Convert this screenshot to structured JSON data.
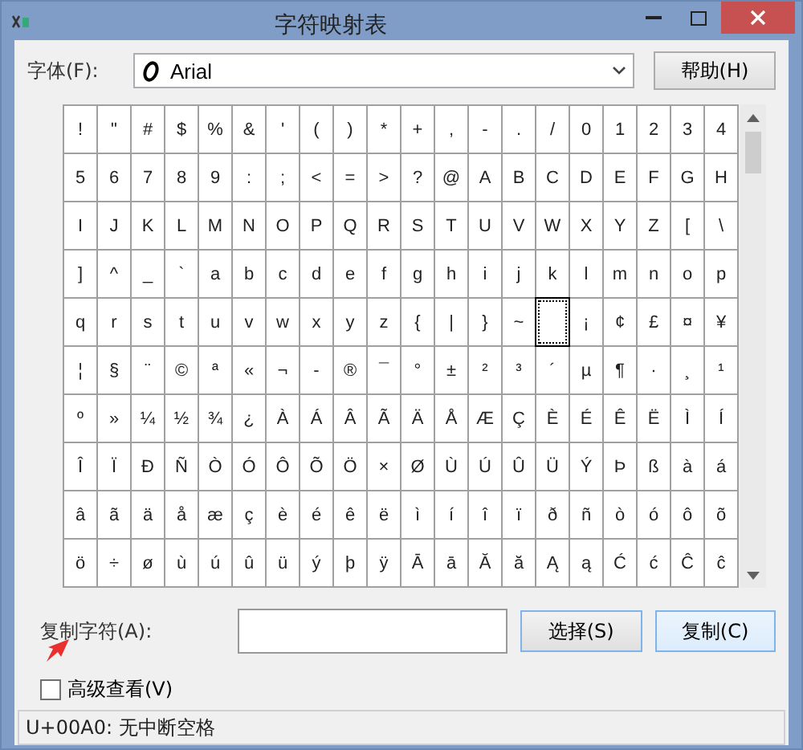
{
  "window": {
    "title": "字符映射表"
  },
  "font": {
    "label": "字体(F):",
    "value": "Arial"
  },
  "help_button": "帮助(H)",
  "grid": {
    "rows": [
      {
        "cells": [
          {
            "char": "!",
            "selected": false
          },
          {
            "char": "\"",
            "selected": false
          },
          {
            "char": "#",
            "selected": false
          },
          {
            "char": "$",
            "selected": false
          },
          {
            "char": "%",
            "selected": false
          },
          {
            "char": "&",
            "selected": false
          },
          {
            "char": "'",
            "selected": false
          },
          {
            "char": "(",
            "selected": false
          },
          {
            "char": ")",
            "selected": false
          },
          {
            "char": "*",
            "selected": false
          },
          {
            "char": "+",
            "selected": false
          },
          {
            "char": ",",
            "selected": false
          },
          {
            "char": "-",
            "selected": false
          },
          {
            "char": ".",
            "selected": false
          },
          {
            "char": "/",
            "selected": false
          },
          {
            "char": "0",
            "selected": false
          },
          {
            "char": "1",
            "selected": false
          },
          {
            "char": "2",
            "selected": false
          },
          {
            "char": "3",
            "selected": false
          },
          {
            "char": "4",
            "selected": false
          }
        ]
      },
      {
        "cells": [
          {
            "char": "5",
            "selected": false
          },
          {
            "char": "6",
            "selected": false
          },
          {
            "char": "7",
            "selected": false
          },
          {
            "char": "8",
            "selected": false
          },
          {
            "char": "9",
            "selected": false
          },
          {
            "char": ":",
            "selected": false
          },
          {
            "char": ";",
            "selected": false
          },
          {
            "char": "<",
            "selected": false
          },
          {
            "char": "=",
            "selected": false
          },
          {
            "char": ">",
            "selected": false
          },
          {
            "char": "?",
            "selected": false
          },
          {
            "char": "@",
            "selected": false
          },
          {
            "char": "A",
            "selected": false
          },
          {
            "char": "B",
            "selected": false
          },
          {
            "char": "C",
            "selected": false
          },
          {
            "char": "D",
            "selected": false
          },
          {
            "char": "E",
            "selected": false
          },
          {
            "char": "F",
            "selected": false
          },
          {
            "char": "G",
            "selected": false
          },
          {
            "char": "H",
            "selected": false
          }
        ]
      },
      {
        "cells": [
          {
            "char": "I",
            "selected": false
          },
          {
            "char": "J",
            "selected": false
          },
          {
            "char": "K",
            "selected": false
          },
          {
            "char": "L",
            "selected": false
          },
          {
            "char": "M",
            "selected": false
          },
          {
            "char": "N",
            "selected": false
          },
          {
            "char": "O",
            "selected": false
          },
          {
            "char": "P",
            "selected": false
          },
          {
            "char": "Q",
            "selected": false
          },
          {
            "char": "R",
            "selected": false
          },
          {
            "char": "S",
            "selected": false
          },
          {
            "char": "T",
            "selected": false
          },
          {
            "char": "U",
            "selected": false
          },
          {
            "char": "V",
            "selected": false
          },
          {
            "char": "W",
            "selected": false
          },
          {
            "char": "X",
            "selected": false
          },
          {
            "char": "Y",
            "selected": false
          },
          {
            "char": "Z",
            "selected": false
          },
          {
            "char": "[",
            "selected": false
          },
          {
            "char": "\\",
            "selected": false
          }
        ]
      },
      {
        "cells": [
          {
            "char": "]",
            "selected": false
          },
          {
            "char": "^",
            "selected": false
          },
          {
            "char": "_",
            "selected": false
          },
          {
            "char": "`",
            "selected": false
          },
          {
            "char": "a",
            "selected": false
          },
          {
            "char": "b",
            "selected": false
          },
          {
            "char": "c",
            "selected": false
          },
          {
            "char": "d",
            "selected": false
          },
          {
            "char": "e",
            "selected": false
          },
          {
            "char": "f",
            "selected": false
          },
          {
            "char": "g",
            "selected": false
          },
          {
            "char": "h",
            "selected": false
          },
          {
            "char": "i",
            "selected": false
          },
          {
            "char": "j",
            "selected": false
          },
          {
            "char": "k",
            "selected": false
          },
          {
            "char": "l",
            "selected": false
          },
          {
            "char": "m",
            "selected": false
          },
          {
            "char": "n",
            "selected": false
          },
          {
            "char": "o",
            "selected": false
          },
          {
            "char": "p",
            "selected": false
          }
        ]
      },
      {
        "cells": [
          {
            "char": "q",
            "selected": false
          },
          {
            "char": "r",
            "selected": false
          },
          {
            "char": "s",
            "selected": false
          },
          {
            "char": "t",
            "selected": false
          },
          {
            "char": "u",
            "selected": false
          },
          {
            "char": "v",
            "selected": false
          },
          {
            "char": "w",
            "selected": false
          },
          {
            "char": "x",
            "selected": false
          },
          {
            "char": "y",
            "selected": false
          },
          {
            "char": "z",
            "selected": false
          },
          {
            "char": "{",
            "selected": false
          },
          {
            "char": "|",
            "selected": false
          },
          {
            "char": "}",
            "selected": false
          },
          {
            "char": "~",
            "selected": false
          },
          {
            "selected": true
          },
          {
            "char": "¡",
            "selected": false
          },
          {
            "char": "¢",
            "selected": false
          },
          {
            "char": "£",
            "selected": false
          },
          {
            "char": "¤",
            "selected": false
          },
          {
            "char": "¥",
            "selected": false
          }
        ]
      },
      {
        "cells": [
          {
            "char": "¦",
            "selected": false
          },
          {
            "char": "§",
            "selected": false
          },
          {
            "char": "¨",
            "selected": false
          },
          {
            "char": "©",
            "selected": false
          },
          {
            "char": "ª",
            "selected": false
          },
          {
            "char": "«",
            "selected": false
          },
          {
            "char": "¬",
            "selected": false
          },
          {
            "char": "-",
            "selected": false
          },
          {
            "char": "®",
            "selected": false
          },
          {
            "char": "¯",
            "selected": false
          },
          {
            "char": "°",
            "selected": false
          },
          {
            "char": "±",
            "selected": false
          },
          {
            "char": "²",
            "selected": false
          },
          {
            "char": "³",
            "selected": false
          },
          {
            "char": "´",
            "selected": false
          },
          {
            "char": "µ",
            "selected": false
          },
          {
            "char": "¶",
            "selected": false
          },
          {
            "char": "·",
            "selected": false
          },
          {
            "char": "¸",
            "selected": false
          },
          {
            "char": "¹",
            "selected": false
          }
        ]
      },
      {
        "cells": [
          {
            "char": "º",
            "selected": false
          },
          {
            "char": "»",
            "selected": false
          },
          {
            "char": "¼",
            "selected": false
          },
          {
            "char": "½",
            "selected": false
          },
          {
            "char": "¾",
            "selected": false
          },
          {
            "char": "¿",
            "selected": false
          },
          {
            "char": "À",
            "selected": false
          },
          {
            "char": "Á",
            "selected": false
          },
          {
            "char": "Â",
            "selected": false
          },
          {
            "char": "Ã",
            "selected": false
          },
          {
            "char": "Ä",
            "selected": false
          },
          {
            "char": "Å",
            "selected": false
          },
          {
            "char": "Æ",
            "selected": false
          },
          {
            "char": "Ç",
            "selected": false
          },
          {
            "char": "È",
            "selected": false
          },
          {
            "char": "É",
            "selected": false
          },
          {
            "char": "Ê",
            "selected": false
          },
          {
            "char": "Ë",
            "selected": false
          },
          {
            "char": "Ì",
            "selected": false
          },
          {
            "char": "Í",
            "selected": false
          }
        ]
      },
      {
        "cells": [
          {
            "char": "Î",
            "selected": false
          },
          {
            "char": "Ï",
            "selected": false
          },
          {
            "char": "Ð",
            "selected": false
          },
          {
            "char": "Ñ",
            "selected": false
          },
          {
            "char": "Ò",
            "selected": false
          },
          {
            "char": "Ó",
            "selected": false
          },
          {
            "char": "Ô",
            "selected": false
          },
          {
            "char": "Õ",
            "selected": false
          },
          {
            "char": "Ö",
            "selected": false
          },
          {
            "char": "×",
            "selected": false
          },
          {
            "char": "Ø",
            "selected": false
          },
          {
            "char": "Ù",
            "selected": false
          },
          {
            "char": "Ú",
            "selected": false
          },
          {
            "char": "Û",
            "selected": false
          },
          {
            "char": "Ü",
            "selected": false
          },
          {
            "char": "Ý",
            "selected": false
          },
          {
            "char": "Þ",
            "selected": false
          },
          {
            "char": "ß",
            "selected": false
          },
          {
            "char": "à",
            "selected": false
          },
          {
            "char": "á",
            "selected": false
          }
        ]
      },
      {
        "cells": [
          {
            "char": "â",
            "selected": false
          },
          {
            "char": "ã",
            "selected": false
          },
          {
            "char": "ä",
            "selected": false
          },
          {
            "char": "å",
            "selected": false
          },
          {
            "char": "æ",
            "selected": false
          },
          {
            "char": "ç",
            "selected": false
          },
          {
            "char": "è",
            "selected": false
          },
          {
            "char": "é",
            "selected": false
          },
          {
            "char": "ê",
            "selected": false
          },
          {
            "char": "ë",
            "selected": false
          },
          {
            "char": "ì",
            "selected": false
          },
          {
            "char": "í",
            "selected": false
          },
          {
            "char": "î",
            "selected": false
          },
          {
            "char": "ï",
            "selected": false
          },
          {
            "char": "ð",
            "selected": false
          },
          {
            "char": "ñ",
            "selected": false
          },
          {
            "char": "ò",
            "selected": false
          },
          {
            "char": "ó",
            "selected": false
          },
          {
            "char": "ô",
            "selected": false
          },
          {
            "char": "õ",
            "selected": false
          }
        ]
      },
      {
        "cells": [
          {
            "char": "ö",
            "selected": false
          },
          {
            "char": "÷",
            "selected": false
          },
          {
            "char": "ø",
            "selected": false
          },
          {
            "char": "ù",
            "selected": false
          },
          {
            "char": "ú",
            "selected": false
          },
          {
            "char": "û",
            "selected": false
          },
          {
            "char": "ü",
            "selected": false
          },
          {
            "char": "ý",
            "selected": false
          },
          {
            "char": "þ",
            "selected": false
          },
          {
            "char": "ÿ",
            "selected": false
          },
          {
            "char": "Ā",
            "selected": false
          },
          {
            "char": "ā",
            "selected": false
          },
          {
            "char": "Ă",
            "selected": false
          },
          {
            "char": "ă",
            "selected": false
          },
          {
            "char": "Ą",
            "selected": false
          },
          {
            "char": "ą",
            "selected": false
          },
          {
            "char": "Ć",
            "selected": false
          },
          {
            "char": "ć",
            "selected": false
          },
          {
            "char": "Ĉ",
            "selected": false
          },
          {
            "char": "ĉ",
            "selected": false
          }
        ]
      }
    ]
  },
  "copy": {
    "label": "复制字符(A):",
    "select_button": "选择(S)",
    "copy_button": "复制(C)"
  },
  "advanced_view": {
    "label": "高级查看(V)",
    "checked": false
  },
  "status_bar": "U+00A0: 无中断空格"
}
